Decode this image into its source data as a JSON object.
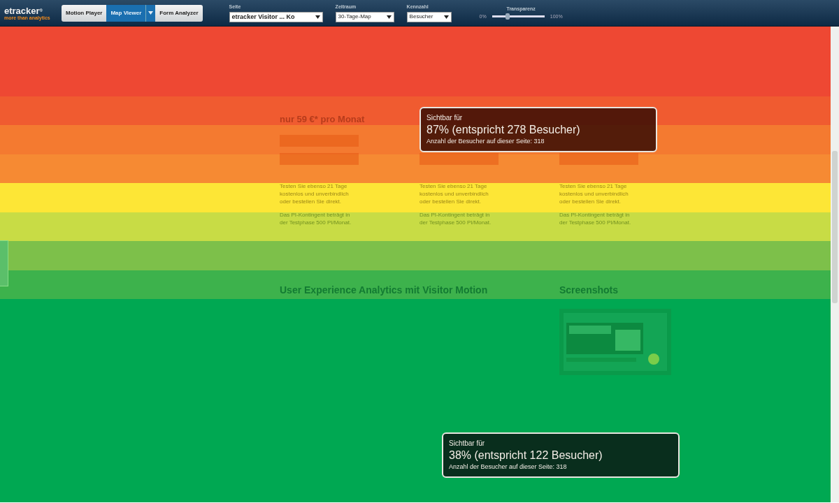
{
  "toolbar": {
    "logo": {
      "text": "etracker",
      "mark": "®",
      "tagline": "more than analytics"
    },
    "modes": [
      {
        "label": "Motion Player",
        "selected": false
      },
      {
        "label": "Map Viewer",
        "selected": true,
        "dropdown": true
      },
      {
        "label": "Form Analyzer",
        "selected": false
      }
    ],
    "filters": [
      {
        "label": "Seite",
        "value": "etracker Visitor ... Ko",
        "kind": "wide"
      },
      {
        "label": "Zeitraum",
        "value": "30-Tage-Map",
        "kind": "normal"
      },
      {
        "label": "Kennzahl",
        "value": "Besucher",
        "kind": "normal"
      }
    ],
    "transparency": {
      "label": "Transparenz",
      "min_label": "0%",
      "max_label": "100%",
      "level": 0.3
    }
  },
  "heatmap": {
    "bands": [
      {
        "color": "#ee4833"
      },
      {
        "color": "#f05b30"
      },
      {
        "color": "#f47a30"
      },
      {
        "color": "#f68a33"
      },
      {
        "color": "#fde636"
      },
      {
        "color": "#c8dc45"
      },
      {
        "color": "#7dc04a"
      },
      {
        "color": "#3db24c"
      },
      {
        "color": "#00a852"
      }
    ]
  },
  "page": {
    "plans": [
      {
        "price": "nur 59 €* pro Monat",
        "trial": "Testen Sie ebenso 21 Tage\nkostenlos und unverbindlich\noder bestellen Sie direkt.",
        "quota": "Das PI-Kontingent beträgt in\nder Testphase 500 PI/Monat."
      },
      {
        "trial": "Testen Sie ebenso 21 Tage\nkostenlos und unverbindlich\noder bestellen Sie direkt.",
        "quota": "Das PI-Kontingent beträgt in\nder Testphase 500 PI/Monat."
      },
      {
        "trial": "Testen Sie ebenso 21 Tage\nkostenlos und unverbindlich\noder bestellen Sie direkt.",
        "quota": "Das PI-Kontingent beträgt in\nder Testphase 500 PI/Monat."
      }
    ],
    "heading": "User Experience Analytics mit Visitor Motion",
    "side_heading": "Screenshots"
  },
  "tooltips": [
    {
      "title": "Sichtbar für",
      "value": "87% (entspricht 278 Besucher)",
      "note": "Anzahl der Besucher auf dieser Seite: 318"
    },
    {
      "title": "Sichtbar für",
      "value": "38% (entspricht 122 Besucher)",
      "note": "Anzahl der Besucher auf dieser Seite: 318"
    }
  ]
}
